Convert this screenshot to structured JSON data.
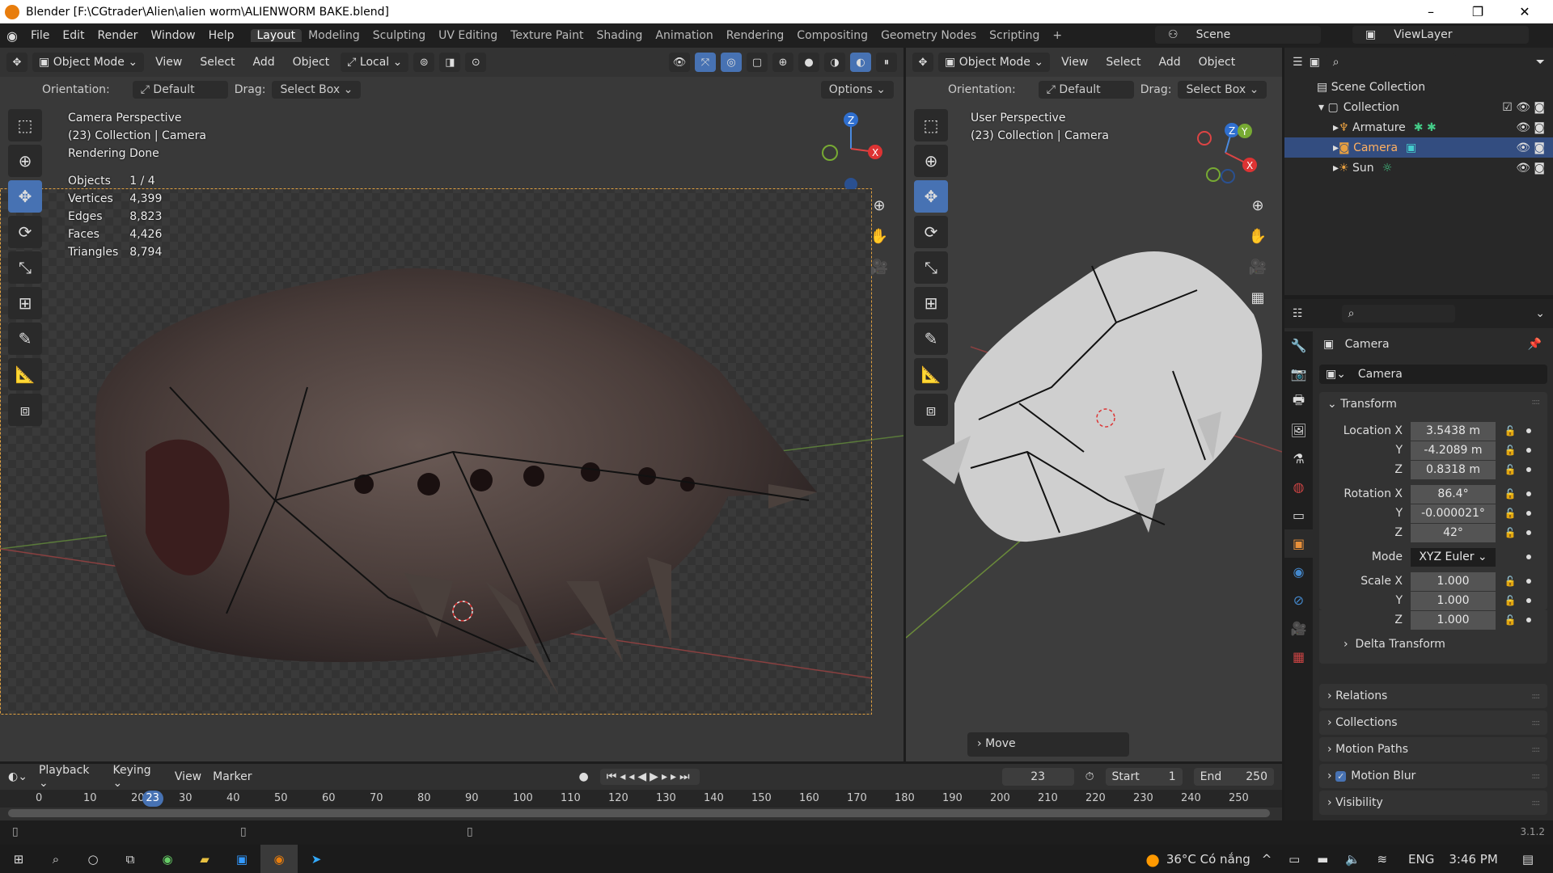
{
  "window": {
    "title": "Blender [F:\\CGtrader\\Alien\\alien worm\\ALIENWORM BAKE.blend]",
    "minimize": "–",
    "maximize": "❐",
    "close": "✕"
  },
  "menu": {
    "items": [
      "File",
      "Edit",
      "Render",
      "Window",
      "Help"
    ],
    "workspaces": [
      "Layout",
      "Modeling",
      "Sculpting",
      "UV Editing",
      "Texture Paint",
      "Shading",
      "Animation",
      "Rendering",
      "Compositing",
      "Geometry Nodes",
      "Scripting",
      "+"
    ],
    "scene": "Scene",
    "view_layer": "ViewLayer"
  },
  "viewport_left": {
    "mode": "Object Mode",
    "menus": [
      "View",
      "Select",
      "Add",
      "Object"
    ],
    "transform_orientation": "Local",
    "orientation_label": "Orientation:",
    "orientation": "Default",
    "drag_label": "Drag:",
    "drag": "Select Box",
    "options": "Options",
    "title": "Camera Perspective",
    "collection": "(23) Collection | Camera",
    "status": "Rendering Done",
    "stats": [
      [
        "Objects",
        "1 / 4"
      ],
      [
        "Vertices",
        "4,399"
      ],
      [
        "Edges",
        "8,823"
      ],
      [
        "Faces",
        "4,426"
      ],
      [
        "Triangles",
        "8,794"
      ]
    ],
    "gizmo": {
      "z": "Z",
      "x": "X"
    }
  },
  "viewport_right": {
    "mode": "Object Mode",
    "menus": [
      "View",
      "Select",
      "Add",
      "Object"
    ],
    "orientation_label": "Orientation:",
    "orientation": "Default",
    "drag_label": "Drag:",
    "drag": "Select Box",
    "title": "User Perspective",
    "collection": "(23) Collection | Camera",
    "gizmo": {
      "z": "Z",
      "y": "Y",
      "x": "X"
    },
    "last_op": "Move"
  },
  "outliner": {
    "root": "Scene Collection",
    "collection": "Collection",
    "items": [
      "Armature",
      "Camera",
      "Sun"
    ],
    "selected": "Camera"
  },
  "properties": {
    "object_name": "Camera",
    "datablock": "Camera",
    "transform": {
      "title": "Transform",
      "location": {
        "label": "Location X",
        "x": "3.5438 m",
        "y": "-4.2089 m",
        "z": "0.8318 m"
      },
      "rotation": {
        "label": "Rotation X",
        "x": "86.4°",
        "y": "-0.000021°",
        "z": "42°"
      },
      "mode_label": "Mode",
      "mode": "XYZ Euler",
      "scale": {
        "label": "Scale X",
        "x": "1.000",
        "y": "1.000",
        "z": "1.000"
      },
      "axis_y": "Y",
      "axis_z": "Z",
      "delta": "Delta Transform"
    },
    "panels": [
      "Relations",
      "Collections",
      "Motion Paths",
      "Motion Blur",
      "Visibility"
    ]
  },
  "timeline": {
    "menus": [
      "Playback",
      "Keying",
      "View",
      "Marker"
    ],
    "current_frame": "23",
    "start_label": "Start",
    "start": "1",
    "end_label": "End",
    "end": "250",
    "ticks": [
      "0",
      "10",
      "20",
      "30",
      "40",
      "50",
      "60",
      "70",
      "80",
      "90",
      "100",
      "110",
      "120",
      "130",
      "140",
      "150",
      "160",
      "170",
      "180",
      "190",
      "200",
      "210",
      "220",
      "230",
      "240",
      "250"
    ]
  },
  "statusbar": {
    "version": "3.1.2"
  },
  "taskbar": {
    "weather": "36°C Có nắng",
    "language": "ENG",
    "time": "3:46 PM"
  },
  "colors": {
    "accent": "#4772b3",
    "selected_row": "#334d80",
    "camera_frame": "#e0a040"
  }
}
